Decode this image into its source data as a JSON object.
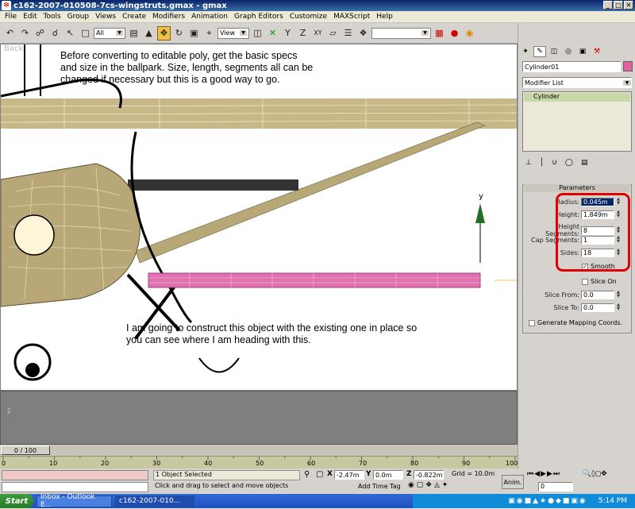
{
  "window": {
    "title": "c162-2007-010508-7cs-wingstruts.gmax - gmax"
  },
  "menu": [
    "File",
    "Edit",
    "Tools",
    "Group",
    "Views",
    "Create",
    "Modifiers",
    "Animation",
    "Graph Editors",
    "Customize",
    "MAXScript",
    "Help"
  ],
  "toolbar": {
    "selection_filter": "All",
    "ref_coord": "View"
  },
  "viewport": {
    "label": "Back",
    "note1": "Before converting to editable poly, get the basic specs\nand size in the ballpark.  Size, length, segments all can be\nchanged if necessary but this is a good way to go.",
    "note2": "I am going to construct this object with the existing one in place so\nyou can see where I am heading with this.",
    "axis_y": "y"
  },
  "timeline": {
    "slider": "0 / 100",
    "ticks": [
      "0",
      "10",
      "20",
      "30",
      "40",
      "50",
      "60",
      "70",
      "80",
      "90",
      "100"
    ]
  },
  "status": {
    "selected": "1 Object Selected",
    "prompt": "Click and drag to select and move objects",
    "x_label": "X",
    "x": "-2.47m",
    "y_label": "Y",
    "y": "0.0m",
    "z_label": "Z",
    "z": "-0.822m",
    "grid": "Grid = 10.0m",
    "add_time_tag": "Add Time Tag",
    "anim_btn": "Anim.",
    "frame": "0"
  },
  "command_panel": {
    "object_name": "Cylinder01",
    "object_color": "#e060a0",
    "modifier_list": "Modifier List",
    "stack_item": "Cylinder",
    "rollout_title": "Parameters",
    "params": [
      {
        "label": "Radius:",
        "value": "0.045m"
      },
      {
        "label": "Height:",
        "value": "1.849m"
      },
      {
        "label": "Height Segments:",
        "value": "8"
      },
      {
        "label": "Cap Segments:",
        "value": "1"
      },
      {
        "label": "Sides:",
        "value": "18"
      }
    ],
    "smooth": "Smooth",
    "slice_on": "Slice On",
    "slice_from": {
      "label": "Slice From:",
      "value": "0.0"
    },
    "slice_to": {
      "label": "Slice To:",
      "value": "0.0"
    },
    "gen_mapping": "Generate Mapping Coords."
  },
  "taskbar": {
    "start": "Start",
    "tasks": [
      "Inbox - Outlook E...",
      "c162-2007-010..."
    ],
    "time": "5:14 PM"
  }
}
